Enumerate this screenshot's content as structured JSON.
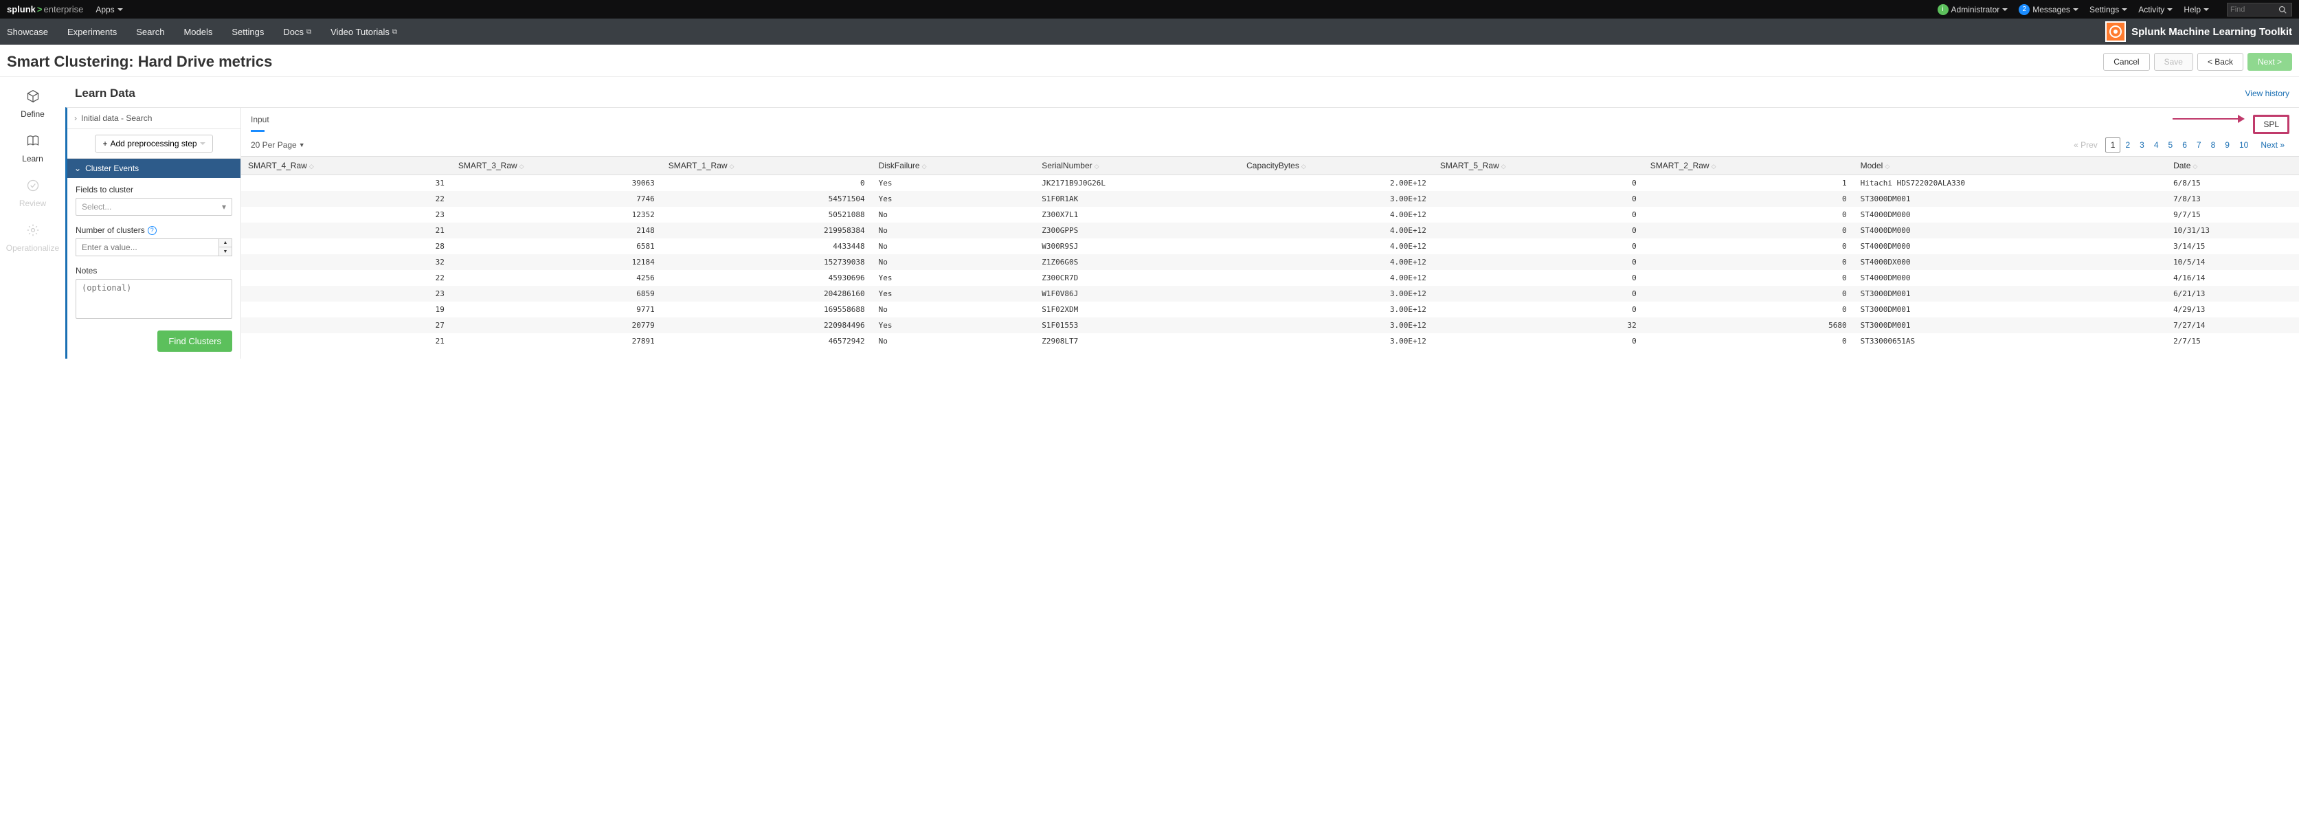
{
  "topbar": {
    "brand_splunk": "splunk",
    "brand_gt": ">",
    "brand_ent": "enterprise",
    "apps": "Apps",
    "admin_badge": "i",
    "admin": "Administrator",
    "messages_badge": "2",
    "messages": "Messages",
    "settings": "Settings",
    "activity": "Activity",
    "help": "Help",
    "find_placeholder": "Find"
  },
  "nav2": {
    "items": [
      "Showcase",
      "Experiments",
      "Search",
      "Models",
      "Settings",
      "Docs",
      "Video Tutorials"
    ],
    "app_title": "Splunk Machine Learning Toolkit"
  },
  "title": "Smart Clustering: Hard Drive metrics",
  "title_buttons": {
    "cancel": "Cancel",
    "save": "Save",
    "back": "< Back",
    "next": "Next >"
  },
  "stages": {
    "define": "Define",
    "learn": "Learn",
    "review": "Review",
    "operationalize": "Operationalize"
  },
  "section": {
    "title": "Learn Data",
    "view_history": "View history"
  },
  "left": {
    "initial_data": "Initial data - Search",
    "add_step": "Add preprocessing step",
    "cluster_events": "Cluster Events",
    "fields_label": "Fields to cluster",
    "fields_placeholder": "Select...",
    "num_label": "Number of clusters",
    "num_placeholder": "Enter a value...",
    "notes_label": "Notes",
    "notes_placeholder": "(optional)",
    "find_clusters": "Find Clusters"
  },
  "dataheader": {
    "input": "Input",
    "spl": "SPL"
  },
  "controls": {
    "per_page": "20 Per Page",
    "prev": "« Prev",
    "pages": [
      "1",
      "2",
      "3",
      "4",
      "5",
      "6",
      "7",
      "8",
      "9",
      "10"
    ],
    "next": "Next »"
  },
  "table": {
    "columns": [
      "SMART_4_Raw",
      "SMART_3_Raw",
      "SMART_1_Raw",
      "DiskFailure",
      "SerialNumber",
      "CapacityBytes",
      "SMART_5_Raw",
      "SMART_2_Raw",
      "Model",
      "Date"
    ],
    "numeric_cols": [
      0,
      1,
      2,
      5,
      6,
      7
    ],
    "rows": [
      [
        "31",
        "39063",
        "0",
        "Yes",
        "JK2171B9J0G26L",
        "2.00E+12",
        "0",
        "1",
        "Hitachi HDS722020ALA330",
        "6/8/15"
      ],
      [
        "22",
        "7746",
        "54571504",
        "Yes",
        "S1F0R1AK",
        "3.00E+12",
        "0",
        "0",
        "ST3000DM001",
        "7/8/13"
      ],
      [
        "23",
        "12352",
        "50521088",
        "No",
        "Z300X7L1",
        "4.00E+12",
        "0",
        "0",
        "ST4000DM000",
        "9/7/15"
      ],
      [
        "21",
        "2148",
        "219958384",
        "No",
        "Z300GPPS",
        "4.00E+12",
        "0",
        "0",
        "ST4000DM000",
        "10/31/13"
      ],
      [
        "28",
        "6581",
        "4433448",
        "No",
        "W300R9SJ",
        "4.00E+12",
        "0",
        "0",
        "ST4000DM000",
        "3/14/15"
      ],
      [
        "32",
        "12184",
        "152739038",
        "No",
        "Z1Z06G0S",
        "4.00E+12",
        "0",
        "0",
        "ST4000DX000",
        "10/5/14"
      ],
      [
        "22",
        "4256",
        "45930696",
        "Yes",
        "Z300CR7D",
        "4.00E+12",
        "0",
        "0",
        "ST4000DM000",
        "4/16/14"
      ],
      [
        "23",
        "6859",
        "204286160",
        "Yes",
        "W1F0V86J",
        "3.00E+12",
        "0",
        "0",
        "ST3000DM001",
        "6/21/13"
      ],
      [
        "19",
        "9771",
        "169558688",
        "No",
        "S1F02XDM",
        "3.00E+12",
        "0",
        "0",
        "ST3000DM001",
        "4/29/13"
      ],
      [
        "27",
        "20779",
        "220984496",
        "Yes",
        "S1F01553",
        "3.00E+12",
        "32",
        "5680",
        "ST3000DM001",
        "7/27/14"
      ],
      [
        "21",
        "27891",
        "46572942",
        "No",
        "Z2908LT7",
        "3.00E+12",
        "0",
        "0",
        "ST33000651AS",
        "2/7/15"
      ]
    ]
  }
}
